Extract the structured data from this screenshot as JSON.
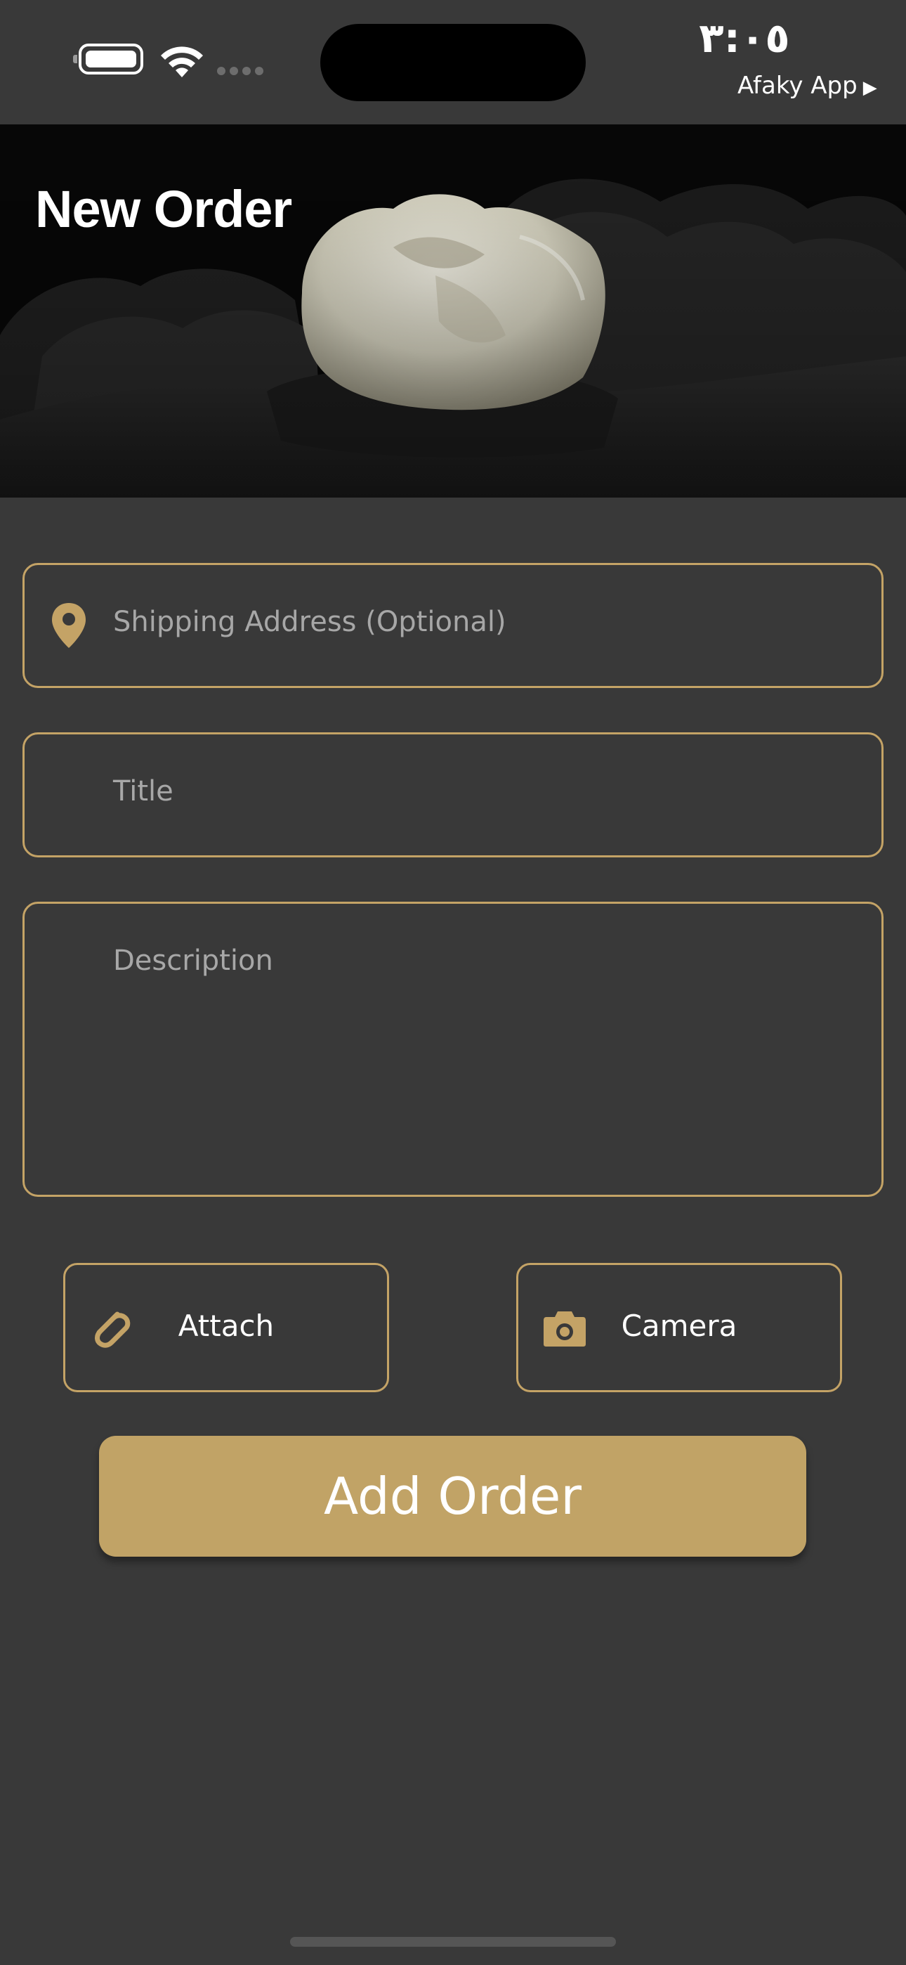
{
  "status_bar": {
    "time": "٣:٠٥",
    "back_app_label": "Afaky App",
    "back_app_arrow": "▶"
  },
  "header": {
    "title": "New Order"
  },
  "form": {
    "shipping_placeholder": "Shipping Address (Optional)",
    "title_placeholder": "Title",
    "description_placeholder": "Description"
  },
  "actions": {
    "attach_label": "Attach",
    "camera_label": "Camera",
    "add_order_label": "Add Order"
  },
  "icons": {
    "pin": "location-pin-icon",
    "attach": "paperclip-icon",
    "camera": "camera-icon"
  },
  "colors": {
    "background": "#393939",
    "accent": "#c1a366",
    "border": "#c4a366",
    "placeholder": "#a7a7a7"
  }
}
